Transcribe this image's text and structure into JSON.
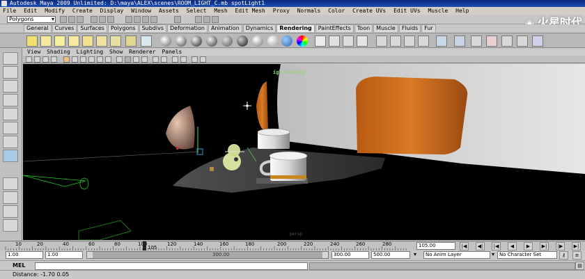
{
  "window": {
    "title": "Autodesk Maya 2009 Unlimited: D:\\maya\\ALEX\\scenes\\ROOM_LIGHT_C.mb    spotLight1"
  },
  "menubar": [
    "File",
    "Edit",
    "Modify",
    "Create",
    "Display",
    "Window",
    "Assets",
    "Select",
    "Mesh",
    "Edit Mesh",
    "Proxy",
    "Normals",
    "Color",
    "Create UVs",
    "Edit UVs",
    "Muscle",
    "Help"
  ],
  "status_line": {
    "mode": "Polygons"
  },
  "shelf_tabs": [
    "General",
    "Curves",
    "Surfaces",
    "Polygons",
    "Subdivs",
    "Deformation",
    "Animation",
    "Dynamics",
    "Rendering",
    "PaintEffects",
    "Toon",
    "Muscle",
    "Fluids",
    "Fur"
  ],
  "shelf_active_tab": "Rendering",
  "panel_menu": [
    "View",
    "Shading",
    "Lighting",
    "Show",
    "Renderer",
    "Panels"
  ],
  "viewport": {
    "renderer_label": "igh Quality",
    "camera_label": "persp"
  },
  "timeline": {
    "ticks": [
      "10",
      "20",
      "40",
      "60",
      "80",
      "100",
      "120",
      "140",
      "160",
      "180",
      "200",
      "220",
      "240",
      "260",
      "280"
    ],
    "current_frame_marker": "105",
    "current_frame_field": "105.00"
  },
  "range": {
    "start_time": "1.00",
    "playback_start": "1.00",
    "slider_label": "300.00",
    "playback_end": "300.00",
    "end_time": "500.00",
    "anim_layer": "No Anim Layer",
    "character_set": "No Character Set"
  },
  "command_line": {
    "label": "MEL",
    "value": ""
  },
  "help_line": {
    "text": "Distance: -1.70   0.05"
  },
  "colors": {
    "viewport_bg": "#000000",
    "title_bar": "#1c4fb8",
    "ui_gray": "#c8c8c8"
  }
}
